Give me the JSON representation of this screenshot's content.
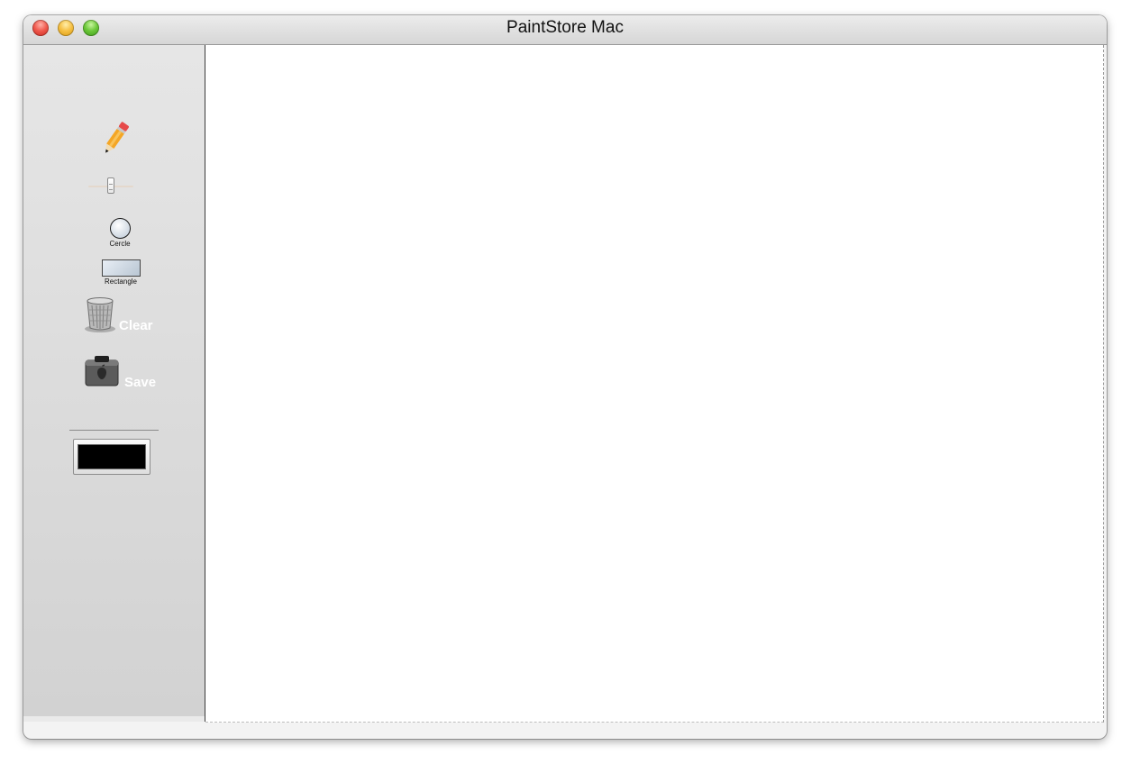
{
  "window": {
    "title": "PaintStore Mac"
  },
  "toolbar": {
    "pencil_icon": "pencil-icon",
    "circle_label": "Cercle",
    "rectangle_label": "Rectangle",
    "clear_label": "Clear",
    "clear_icon": "trash-icon",
    "save_label": "Save",
    "save_icon": "drive-icon"
  },
  "stroke_slider": {
    "value_fraction": 0.5
  },
  "color_well": {
    "color": "#000000"
  },
  "colors": {
    "close": "#f05a4e",
    "minimize": "#f6c044",
    "zoom": "#6cc83a",
    "button_text": "#ffffff",
    "canvas_background": "#ffffff"
  }
}
